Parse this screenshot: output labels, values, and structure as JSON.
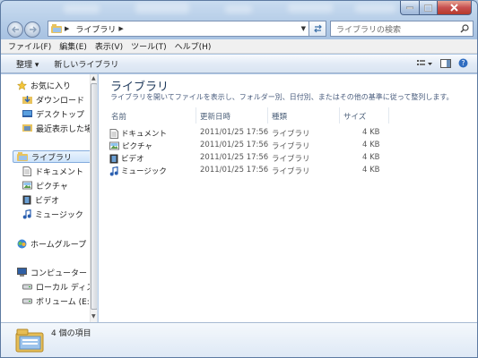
{
  "window": {
    "caption_buttons": {
      "minimize": "minimize",
      "maximize": "maximize",
      "close": "close"
    }
  },
  "address": {
    "crumbs": [
      "ライブラリ"
    ],
    "search_placeholder": "ライブラリの検索"
  },
  "menu": [
    "ファイル(F)",
    "編集(E)",
    "表示(V)",
    "ツール(T)",
    "ヘルプ(H)"
  ],
  "commands": {
    "organize": "整理 ▾",
    "new_library": "新しいライブラリ"
  },
  "navpane": {
    "favorites": "お気に入り",
    "favorites_items": [
      "ダウンロード",
      "デスクトップ",
      "最近表示した場所"
    ],
    "libraries": "ライブラリ",
    "library_items": [
      "ドキュメント",
      "ピクチャ",
      "ビデオ",
      "ミュージック"
    ],
    "homegroup": "ホームグループ",
    "computer": "コンピューター",
    "computer_items": [
      "ローカル ディスク",
      "ボリューム (E:)"
    ]
  },
  "content": {
    "title": "ライブラリ",
    "description": "ライブラリを開いてファイルを表示し、フォルダー別、日付別、またはその他の基準に従って整列します。",
    "columns": {
      "name": "名前",
      "date": "更新日時",
      "type": "種類",
      "size": "サイズ"
    },
    "rows": [
      {
        "name": "ドキュメント",
        "date": "2011/01/25 17:56",
        "type": "ライブラリ",
        "size": "4 KB",
        "icon": "documents-library-icon"
      },
      {
        "name": "ピクチャ",
        "date": "2011/01/25 17:56",
        "type": "ライブラリ",
        "size": "4 KB",
        "icon": "pictures-library-icon"
      },
      {
        "name": "ビデオ",
        "date": "2011/01/25 17:56",
        "type": "ライブラリ",
        "size": "4 KB",
        "icon": "videos-library-icon"
      },
      {
        "name": "ミュージック",
        "date": "2011/01/25 17:56",
        "type": "ライブラリ",
        "size": "4 KB",
        "icon": "music-library-icon"
      }
    ]
  },
  "details": {
    "count": "4 個の項目"
  },
  "colors": {
    "title_blue": "#1e395b",
    "accent": "#84acdd"
  }
}
